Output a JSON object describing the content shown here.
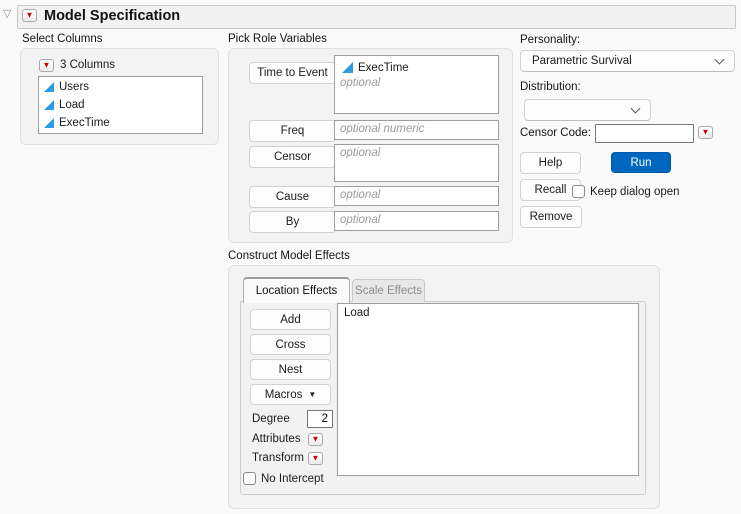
{
  "window": {
    "title": "Model Specification"
  },
  "colors": {
    "accent_blue": "#0067c0",
    "red_triangle": "#cc0000",
    "continuous_column_blue": "#2d9ce2"
  },
  "select_columns": {
    "title": "Select Columns",
    "summary": "3 Columns",
    "items": [
      {
        "label": "Users"
      },
      {
        "label": "Load"
      },
      {
        "label": "ExecTime"
      }
    ]
  },
  "pick_roles": {
    "title": "Pick Role Variables",
    "time_to_event": {
      "button": "Time to Event",
      "value": "ExecTime",
      "placeholder": "optional"
    },
    "freq": {
      "button": "Freq",
      "placeholder": "optional numeric"
    },
    "censor": {
      "button": "Censor",
      "placeholder": "optional"
    },
    "cause": {
      "button": "Cause",
      "placeholder": "optional"
    },
    "by": {
      "button": "By",
      "placeholder": "optional"
    }
  },
  "model_setup": {
    "personality_label": "Personality:",
    "personality_value": "Parametric Survival",
    "distribution_label": "Distribution:",
    "distribution_value": "",
    "censor_code_label": "Censor Code:",
    "censor_code_value": "",
    "help_button": "Help",
    "run_button": "Run",
    "recall_button": "Recall",
    "remove_button": "Remove",
    "keep_dialog_label": "Keep dialog open"
  },
  "construct_effects": {
    "title": "Construct Model Effects",
    "tabs": [
      {
        "label": "Location Effects"
      },
      {
        "label": "Scale Effects"
      }
    ],
    "add_button": "Add",
    "cross_button": "Cross",
    "nest_button": "Nest",
    "macros_button": "Macros",
    "degree_label": "Degree",
    "degree_value": "2",
    "attributes_label": "Attributes",
    "transform_label": "Transform",
    "no_intercept_label": "No Intercept",
    "effects": [
      {
        "label": "Load"
      }
    ]
  }
}
